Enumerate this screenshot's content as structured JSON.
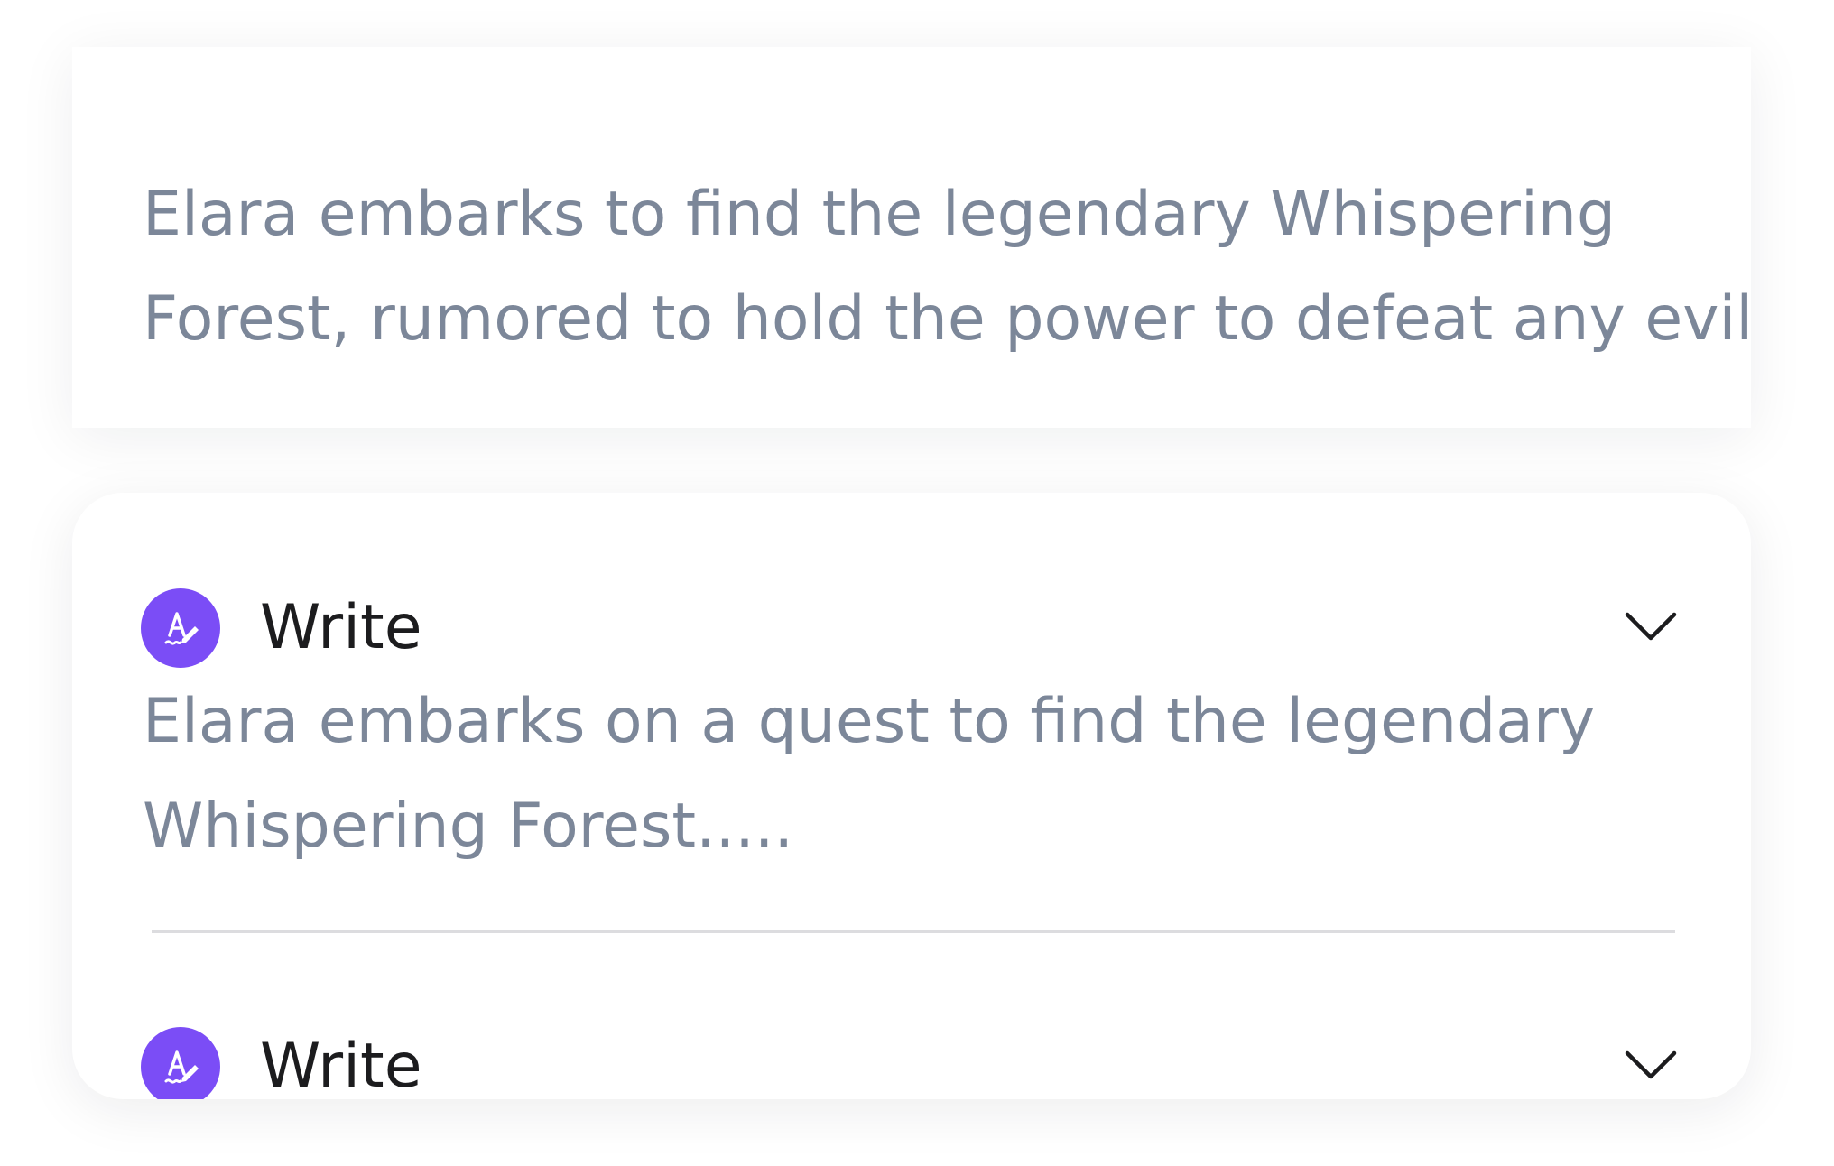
{
  "top_card": {
    "text": "Elara embarks to find the legendary Whispering\nForest, rumored to hold the power to defeat any evil"
  },
  "panel": {
    "items": [
      {
        "title": "Write",
        "icon": "write-ai-icon",
        "expand_icon": "chevron-down-icon",
        "body": "Elara embarks on a quest to find the legendary\nWhispering Forest....."
      },
      {
        "title": "Write",
        "icon": "write-ai-icon",
        "expand_icon": "chevron-down-icon"
      }
    ]
  },
  "colors": {
    "accent": "#7b4df6",
    "body_text": "#7c8799",
    "title_text": "#1c1c1e",
    "divider": "#dcdcdf"
  }
}
